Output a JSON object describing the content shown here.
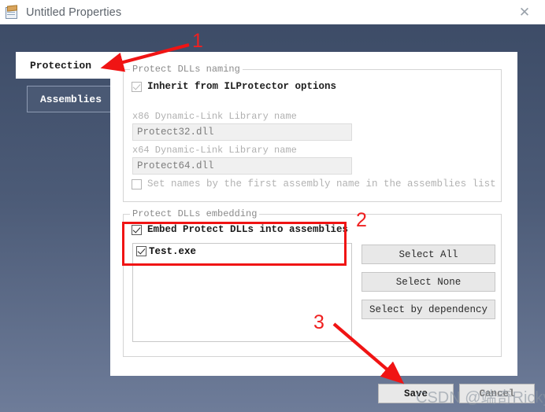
{
  "window": {
    "title": "Untitled Properties",
    "icon": "properties-document-icon",
    "close_label": "✕"
  },
  "tabs": [
    {
      "label": "Protection",
      "active": true
    },
    {
      "label": "Assemblies",
      "active": false
    }
  ],
  "groups": {
    "naming": {
      "title": "Protect DLLs naming",
      "inherit_checkbox": {
        "label": "Inherit from ILProtector options",
        "checked": true,
        "enabled": false
      },
      "x86_label": "x86 Dynamic-Link Library name",
      "x86_value": "Protect32.dll",
      "x64_label": "x64 Dynamic-Link Library name",
      "x64_value": "Protect64.dll",
      "set_names_checkbox": {
        "label": "Set names by the first assembly name in the assemblies list",
        "checked": false,
        "enabled": false
      }
    },
    "embedding": {
      "title": "Protect DLLs embedding",
      "embed_checkbox": {
        "label": "Embed Protect DLLs into assemblies",
        "checked": true,
        "enabled": true
      },
      "assembly_list": [
        {
          "label": "Test.exe",
          "checked": true
        }
      ],
      "buttons": [
        {
          "label": "Select All"
        },
        {
          "label": "Select None"
        },
        {
          "label": "Select by dependency"
        }
      ]
    }
  },
  "footer": {
    "buttons": [
      {
        "label": "Save"
      },
      {
        "label": "Cancel"
      }
    ]
  },
  "annotations": {
    "numbers": [
      {
        "text": "1"
      },
      {
        "text": "2"
      },
      {
        "text": "3"
      }
    ],
    "color": "#f01414"
  },
  "watermark": {
    "text": "CSDN @端奇Ricky"
  }
}
